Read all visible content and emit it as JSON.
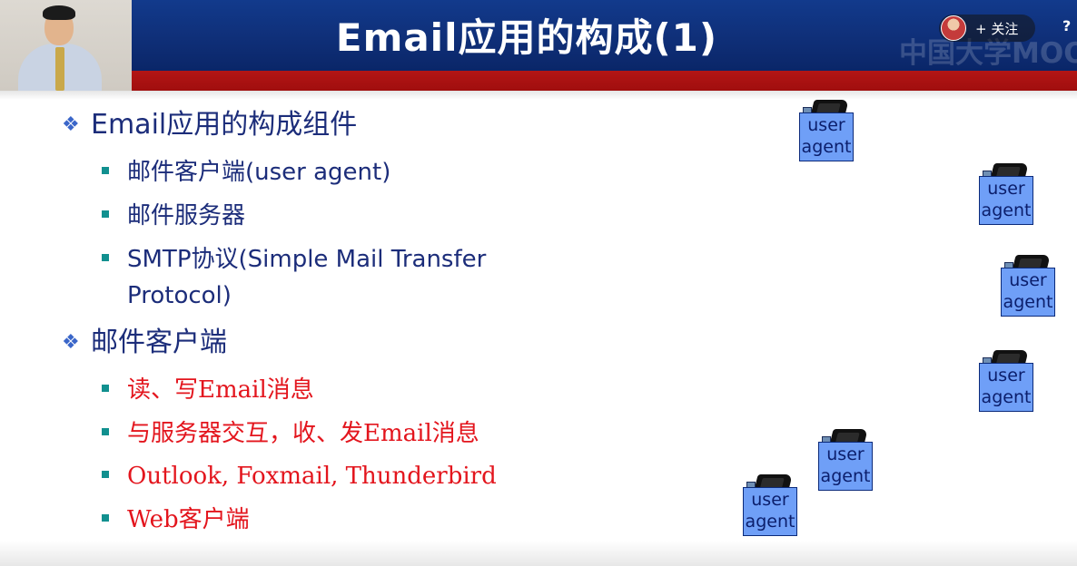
{
  "slide": {
    "title": "Email应用的构成(1)"
  },
  "overlay": {
    "follow_label": "+ 关注",
    "watermark": "中国大学MOOC",
    "corner_glyph": "?"
  },
  "content": {
    "bullet1": {
      "text": "Email应用的构成组件",
      "sub": [
        "邮件客户端(user agent)",
        "邮件服务器",
        "SMTP协议(Simple Mail Transfer"
      ],
      "sub_cont": "Protocol)"
    },
    "bullet2": {
      "text": "邮件客户端",
      "sub": [
        "读、写Email消息",
        "与服务器交互，收、发Email消息",
        "Outlook, Foxmail, Thunderbird",
        "Web客户端"
      ]
    }
  },
  "user_agent": {
    "line1": "user",
    "line2": "agent"
  },
  "colors": {
    "header_blue": "#123a8c",
    "header_red": "#b31515",
    "text_blue": "#1c2d7a",
    "text_red": "#e3151d",
    "agent_box": "#6f9ff7"
  },
  "icons": {
    "level1_bullet": "diamond-cluster-icon",
    "level2_bullet": "teal-square-icon",
    "computer": "computer-monitor-icon"
  }
}
